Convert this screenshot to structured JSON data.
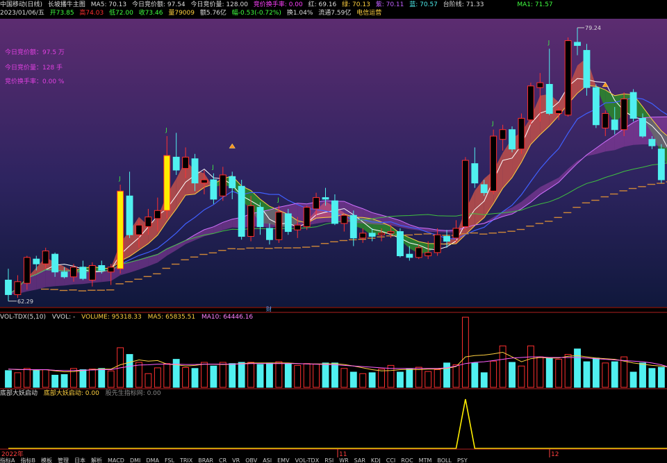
{
  "header": {
    "title": "中国移动(日线)",
    "indicator": "长坡播牛主图",
    "ma5": "MA5: 70.13",
    "bid_amount": "今日竞价额: 97.54",
    "bid_volume": "今日竞价量: 128.00",
    "bid_turnover": "竞价换手率: 0.00",
    "red": "红: 69.16",
    "green": "绿: 70.13",
    "purple": "紫: 70.11",
    "blue": "蓝: 70.57",
    "step_line": "台阶线: 71.33",
    "ma1": "MA1: 71.57"
  },
  "quote": {
    "date": "2023/01/06/五",
    "open": "开73.85",
    "high": "高74.03",
    "low": "低72.00",
    "close": "收73.46",
    "volume": "量79009",
    "amount": "额5.76亿",
    "change": "幅-0.53(-0.72%)",
    "turnover": "换1.04%",
    "float": "流通7.59亿",
    "sector": "电信运营"
  },
  "left_notes": {
    "bid_amount": "今日竞价额：97.5 万",
    "bid_volume": "今日竞价量：128 手",
    "bid_turnover": "竞价换手率：0.00 %"
  },
  "markers": {
    "high": "79.24",
    "low": "62.29",
    "finance": "财",
    "j": "J"
  },
  "vol_panel": {
    "title": "VOL-TDX(5,10)",
    "vvol": "VVOL: -",
    "volume": "VOLUME: 95318.33",
    "ma5": "MA5: 65835.51",
    "ma10": "MA10: 64446.16"
  },
  "ind_panel": {
    "title": "底部大妖启动",
    "value": "底部大妖启动: 0.00",
    "sub": "股先生指标网: 0.00"
  },
  "time_axis": {
    "start": "2022年",
    "m11": "11",
    "m12": "12"
  },
  "tabs": [
    "指标A",
    "指标B",
    "模板",
    "管理",
    "日本",
    "解析",
    "MACD",
    "DMI",
    "DMA",
    "FSL",
    "TRIX",
    "BRAR",
    "CR",
    "VR",
    "OBV",
    "ASI",
    "EMV",
    "VOL-TDX",
    "RSI",
    "WR",
    "SAR",
    "KDJ",
    "CCI",
    "ROC",
    "MTM",
    "BOLL",
    "PSY"
  ],
  "chart_data": {
    "type": "candlestick",
    "price_range": [
      62.29,
      79.24
    ],
    "candles": [
      {
        "o": 63.6,
        "h": 64.3,
        "l": 62.3,
        "c": 62.7
      },
      {
        "o": 62.7,
        "h": 63.9,
        "l": 62.5,
        "c": 63.5
      },
      {
        "o": 63.4,
        "h": 65.1,
        "l": 63.0,
        "c": 65.0
      },
      {
        "o": 64.9,
        "h": 65.1,
        "l": 64.2,
        "c": 64.6
      },
      {
        "o": 64.6,
        "h": 65.6,
        "l": 64.3,
        "c": 65.4
      },
      {
        "o": 65.2,
        "h": 65.3,
        "l": 63.8,
        "c": 64.1
      },
      {
        "o": 64.1,
        "h": 64.4,
        "l": 63.7,
        "c": 63.8
      },
      {
        "o": 63.8,
        "h": 64.6,
        "l": 63.5,
        "c": 64.4
      },
      {
        "o": 64.4,
        "h": 64.8,
        "l": 63.6,
        "c": 63.7
      },
      {
        "o": 63.6,
        "h": 64.7,
        "l": 63.2,
        "c": 64.5
      },
      {
        "o": 64.5,
        "h": 64.8,
        "l": 64.0,
        "c": 64.2
      },
      {
        "o": 64.1,
        "h": 64.6,
        "l": 63.3,
        "c": 64.4
      },
      {
        "o": 64.3,
        "h": 69.5,
        "l": 64.0,
        "c": 69.1
      },
      {
        "o": 68.8,
        "h": 70.3,
        "l": 66.2,
        "c": 66.4
      },
      {
        "o": 66.4,
        "h": 67.3,
        "l": 65.6,
        "c": 67.0
      },
      {
        "o": 66.9,
        "h": 68.0,
        "l": 66.4,
        "c": 67.5
      },
      {
        "o": 67.4,
        "h": 68.7,
        "l": 66.6,
        "c": 67.9
      },
      {
        "o": 67.9,
        "h": 72.5,
        "l": 67.4,
        "c": 71.3
      },
      {
        "o": 71.2,
        "h": 72.7,
        "l": 70.1,
        "c": 70.4
      },
      {
        "o": 70.5,
        "h": 71.8,
        "l": 69.9,
        "c": 71.2
      },
      {
        "o": 71.1,
        "h": 71.4,
        "l": 69.1,
        "c": 69.6
      },
      {
        "o": 69.6,
        "h": 70.4,
        "l": 68.9,
        "c": 69.8
      },
      {
        "o": 69.8,
        "h": 70.2,
        "l": 68.3,
        "c": 68.6
      },
      {
        "o": 68.8,
        "h": 70.6,
        "l": 68.5,
        "c": 70.1
      },
      {
        "o": 70.0,
        "h": 70.3,
        "l": 68.6,
        "c": 69.3
      },
      {
        "o": 69.4,
        "h": 69.8,
        "l": 66.1,
        "c": 66.3
      },
      {
        "o": 66.3,
        "h": 68.8,
        "l": 66.0,
        "c": 68.2
      },
      {
        "o": 68.1,
        "h": 68.4,
        "l": 66.4,
        "c": 66.9
      },
      {
        "o": 66.8,
        "h": 67.1,
        "l": 65.8,
        "c": 66.1
      },
      {
        "o": 66.1,
        "h": 68.2,
        "l": 65.9,
        "c": 67.8
      },
      {
        "o": 67.7,
        "h": 68.0,
        "l": 66.4,
        "c": 66.6
      },
      {
        "o": 66.7,
        "h": 67.5,
        "l": 66.2,
        "c": 67.0
      },
      {
        "o": 66.9,
        "h": 68.2,
        "l": 66.7,
        "c": 68.1
      },
      {
        "o": 68.0,
        "h": 69.0,
        "l": 67.6,
        "c": 68.7
      },
      {
        "o": 68.7,
        "h": 69.3,
        "l": 68.2,
        "c": 68.6
      },
      {
        "o": 68.5,
        "h": 68.9,
        "l": 67.0,
        "c": 67.1
      },
      {
        "o": 67.1,
        "h": 67.7,
        "l": 66.6,
        "c": 67.6
      },
      {
        "o": 67.6,
        "h": 67.9,
        "l": 65.7,
        "c": 66.2
      },
      {
        "o": 66.2,
        "h": 66.8,
        "l": 65.9,
        "c": 66.5
      },
      {
        "o": 66.5,
        "h": 66.8,
        "l": 66.0,
        "c": 66.3
      },
      {
        "o": 66.4,
        "h": 66.8,
        "l": 66.0,
        "c": 66.5
      },
      {
        "o": 66.5,
        "h": 67.0,
        "l": 66.2,
        "c": 66.6
      },
      {
        "o": 66.6,
        "h": 66.8,
        "l": 65.0,
        "c": 65.1
      },
      {
        "o": 65.2,
        "h": 65.7,
        "l": 64.8,
        "c": 65.0
      },
      {
        "o": 65.0,
        "h": 65.8,
        "l": 64.9,
        "c": 65.6
      },
      {
        "o": 65.1,
        "h": 66.0,
        "l": 64.9,
        "c": 65.3
      },
      {
        "o": 65.3,
        "h": 66.8,
        "l": 65.1,
        "c": 66.4
      },
      {
        "o": 66.3,
        "h": 66.7,
        "l": 65.6,
        "c": 66.0
      },
      {
        "o": 66.2,
        "h": 67.3,
        "l": 65.9,
        "c": 66.8
      },
      {
        "o": 66.9,
        "h": 71.2,
        "l": 66.7,
        "c": 71.0
      },
      {
        "o": 70.8,
        "h": 71.8,
        "l": 69.3,
        "c": 69.6
      },
      {
        "o": 69.5,
        "h": 69.8,
        "l": 68.8,
        "c": 69.0
      },
      {
        "o": 69.1,
        "h": 72.9,
        "l": 68.9,
        "c": 72.5
      },
      {
        "o": 72.3,
        "h": 73.2,
        "l": 71.6,
        "c": 72.9
      },
      {
        "o": 72.9,
        "h": 73.1,
        "l": 71.5,
        "c": 71.7
      },
      {
        "o": 71.7,
        "h": 73.9,
        "l": 71.4,
        "c": 73.6
      },
      {
        "o": 73.5,
        "h": 75.8,
        "l": 73.2,
        "c": 75.6
      },
      {
        "o": 75.5,
        "h": 76.4,
        "l": 73.4,
        "c": 75.8
      },
      {
        "o": 75.7,
        "h": 77.9,
        "l": 73.8,
        "c": 73.9
      },
      {
        "o": 73.9,
        "h": 74.3,
        "l": 73.5,
        "c": 74.1
      },
      {
        "o": 73.8,
        "h": 78.6,
        "l": 73.7,
        "c": 78.4
      },
      {
        "o": 78.3,
        "h": 79.2,
        "l": 77.5,
        "c": 78.1
      },
      {
        "o": 77.8,
        "h": 78.2,
        "l": 75.0,
        "c": 75.5
      },
      {
        "o": 75.5,
        "h": 75.7,
        "l": 73.0,
        "c": 73.2
      },
      {
        "o": 73.0,
        "h": 74.1,
        "l": 72.5,
        "c": 73.9
      },
      {
        "o": 73.5,
        "h": 74.3,
        "l": 72.6,
        "c": 72.9
      },
      {
        "o": 72.9,
        "h": 75.2,
        "l": 72.5,
        "c": 74.8
      },
      {
        "o": 75.2,
        "h": 75.4,
        "l": 73.4,
        "c": 73.6
      },
      {
        "o": 73.6,
        "h": 73.9,
        "l": 72.4,
        "c": 72.5
      },
      {
        "o": 72.3,
        "h": 72.5,
        "l": 71.7,
        "c": 71.9
      },
      {
        "o": 71.7,
        "h": 72.0,
        "l": 69.6,
        "c": 69.8
      },
      {
        "o": 69.9,
        "h": 70.5,
        "l": 69.0,
        "c": 69.3
      }
    ],
    "volume_range": [
      0,
      230000
    ],
    "volume": [
      55000,
      48000,
      62000,
      55000,
      58000,
      40000,
      42000,
      62000,
      58000,
      60000,
      62000,
      54000,
      130000,
      108000,
      82000,
      45000,
      64000,
      78000,
      92000,
      65000,
      62000,
      82000,
      70000,
      82000,
      78000,
      82000,
      82000,
      75000,
      80000,
      84000,
      78000,
      72000,
      78000,
      76000,
      80000,
      80000,
      62000,
      50000,
      45000,
      48000,
      60000,
      72000,
      50000,
      60000,
      66000,
      52000,
      58000,
      80000,
      74000,
      230000,
      80000,
      48000,
      86000,
      136000,
      82000,
      70000,
      136000,
      100000,
      95000,
      92000,
      108000,
      126000,
      84000,
      96000,
      80000,
      84000,
      100000,
      50000,
      80000,
      62000,
      66000,
      95318
    ],
    "volume_ma5": [
      60000,
      58000,
      58000,
      57000,
      58000,
      54000,
      51000,
      52000,
      55000,
      58000,
      60000,
      60000,
      74000,
      82000,
      90000,
      86000,
      88000,
      76000,
      74000,
      70000,
      72000,
      76000,
      76000,
      75000,
      76000,
      78000,
      80000,
      80000,
      80000,
      80000,
      80000,
      78000,
      77000,
      77000,
      77000,
      78000,
      75000,
      70000,
      64000,
      58000,
      54000,
      55000,
      58000,
      59000,
      58000,
      60000,
      60000,
      62000,
      68000,
      100000,
      104000,
      106000,
      110000,
      115000,
      100000,
      84000,
      94000,
      98000,
      96000,
      96000,
      102000,
      104000,
      100000,
      96000,
      94000,
      92000,
      86000,
      80000,
      76000,
      72000,
      70000,
      66000
    ],
    "volume_ma10": [
      60000,
      59000,
      58000,
      58000,
      58000,
      56000,
      55000,
      55000,
      56000,
      57000,
      58000,
      58000,
      64000,
      69000,
      73000,
      74000,
      76000,
      76000,
      76000,
      75000,
      75000,
      76000,
      76000,
      76000,
      76000,
      77000,
      78000,
      78000,
      78000,
      78000,
      78000,
      78000,
      77000,
      76000,
      75000,
      74000,
      72000,
      70000,
      68000,
      66000,
      64000,
      62000,
      62000,
      62000,
      62000,
      62000,
      62000,
      64000,
      70000,
      78000,
      82000,
      84000,
      88000,
      92000,
      96000,
      98000,
      100000,
      100000,
      98000,
      98000,
      98000,
      98000,
      96000,
      94000,
      92000,
      90000,
      88000,
      86000,
      84000,
      80000,
      74000,
      64446
    ],
    "signal": {
      "index": 49,
      "value": 1
    }
  }
}
